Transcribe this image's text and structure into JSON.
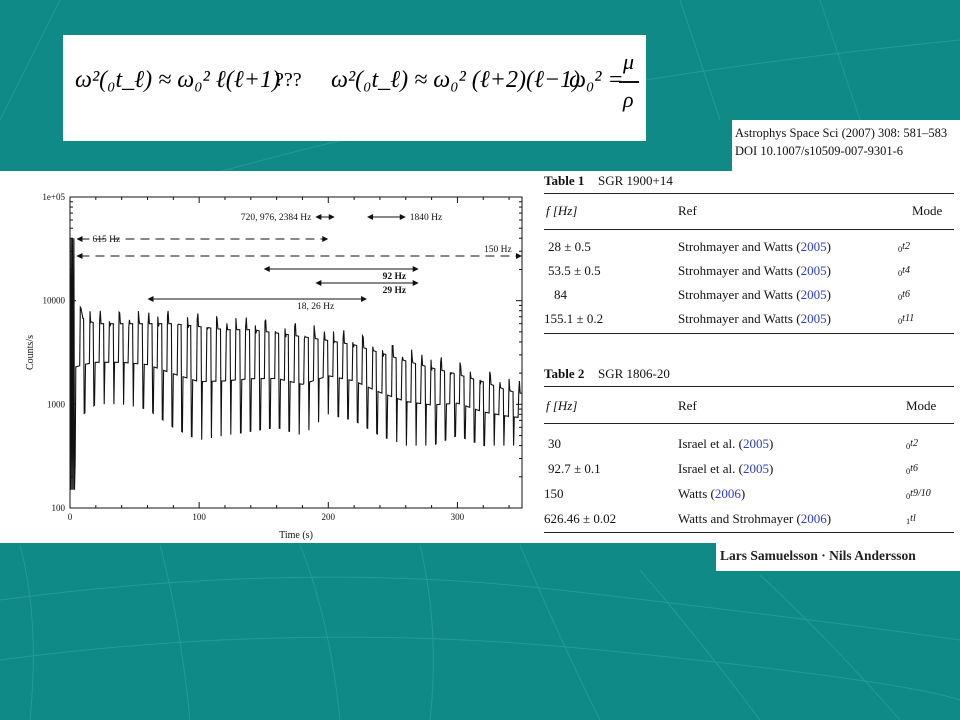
{
  "formulas": {
    "f1": "ω²(₀t_ℓ) ≈ ω₀² ℓ(ℓ+1)",
    "qmarks": "???",
    "f2": "ω²(₀t_ℓ) ≈ ω₀² (ℓ+2)(ℓ−1)",
    "f3_lhs": "ω₀² =",
    "f3_num": "μ",
    "f3_den": "ρ"
  },
  "citation": {
    "line1": "Astrophys Space Sci (2007) 308: 581–583",
    "line2": "DOI 10.1007/s10509-007-9301-6"
  },
  "authors": "Lars Samuelsson · Nils Andersson",
  "chart_data": {
    "type": "line",
    "xlabel": "Time (s)",
    "ylabel": "Counts/s",
    "ylog": true,
    "x_ticks": [
      "0",
      "100",
      "200",
      "300"
    ],
    "y_ticks": [
      "100",
      "1000",
      "10000",
      "1e+05"
    ],
    "xlim": [
      0,
      350
    ],
    "ylim": [
      100,
      100000
    ],
    "annotations": [
      {
        "text": "720, 976, 2384 Hz",
        "x_start": 190,
        "x_end": 205
      },
      {
        "text": "1840 Hz",
        "x_start": 230,
        "x_end": 260
      },
      {
        "text": "615 Hz",
        "x_start": 5,
        "x_end": 200
      },
      {
        "text": "150 Hz",
        "x_start": 5,
        "x_end": 350
      },
      {
        "text": "92 Hz",
        "x_start": 150,
        "x_end": 270
      },
      {
        "text": "29 Hz",
        "x_start": 190,
        "x_end": 270
      },
      {
        "text": "18, 26 Hz",
        "x_start": 60,
        "x_end": 230
      }
    ],
    "series": [
      {
        "x": [
          0,
          10,
          20,
          40,
          60,
          80,
          100,
          120,
          140,
          160,
          180,
          200,
          220,
          240,
          260,
          280,
          300,
          320,
          340,
          350
        ],
        "y_peak": [
          40000,
          9000,
          8000,
          8000,
          8000,
          8000,
          7500,
          7000,
          7000,
          6500,
          6000,
          5500,
          5000,
          4200,
          3500,
          3000,
          2600,
          2200,
          1800,
          1700
        ],
        "y_trough": [
          150,
          800,
          1000,
          1000,
          900,
          600,
          450,
          500,
          550,
          600,
          500,
          800,
          700,
          500,
          400,
          400,
          500,
          400,
          400,
          400
        ]
      }
    ]
  },
  "table1": {
    "title_bold": "Table 1",
    "title_rest": "SGR 1900+14",
    "headers": [
      "f [Hz]",
      "Ref",
      "Mode"
    ],
    "rows": [
      {
        "f": "28 ± 0.5",
        "ref": "Strohmayer and Watts (",
        "year": "2005",
        "close": ")",
        "mode_pre": "0",
        "mode": "t2"
      },
      {
        "f": "53.5 ± 0.5",
        "ref": "Strohmayer and Watts (",
        "year": "2005",
        "close": ")",
        "mode_pre": "0",
        "mode": "t4"
      },
      {
        "f": "84",
        "ref": "Strohmayer and Watts (",
        "year": "2005",
        "close": ")",
        "mode_pre": "0",
        "mode": "t6"
      },
      {
        "f": "155.1 ± 0.2",
        "ref": "Strohmayer and Watts (",
        "year": "2005",
        "close": ")",
        "mode_pre": "0",
        "mode": "t11"
      }
    ]
  },
  "table2": {
    "title_bold": "Table 2",
    "title_rest": "SGR 1806-20",
    "headers": [
      "f [Hz]",
      "Ref",
      "Mode"
    ],
    "rows": [
      {
        "f": "30",
        "ref": "Israel et al. (",
        "year": "2005",
        "close": ")",
        "mode_pre": "0",
        "mode": "t2"
      },
      {
        "f": "92.7 ± 0.1",
        "ref": "Israel et al. (",
        "year": "2005",
        "close": ")",
        "mode_pre": "0",
        "mode": "t6"
      },
      {
        "f": "150",
        "ref": "Watts (",
        "year": "2006",
        "close": ")",
        "mode_pre": "0",
        "mode": "t9/10"
      },
      {
        "f": "626.46 ± 0.02",
        "ref": "Watts and Strohmayer (",
        "year": "2006",
        "close": ")",
        "mode_pre": "1",
        "mode": "tl"
      }
    ]
  },
  "colors": {
    "background": "#0f8a87",
    "citation_link": "#2a3bd6"
  }
}
